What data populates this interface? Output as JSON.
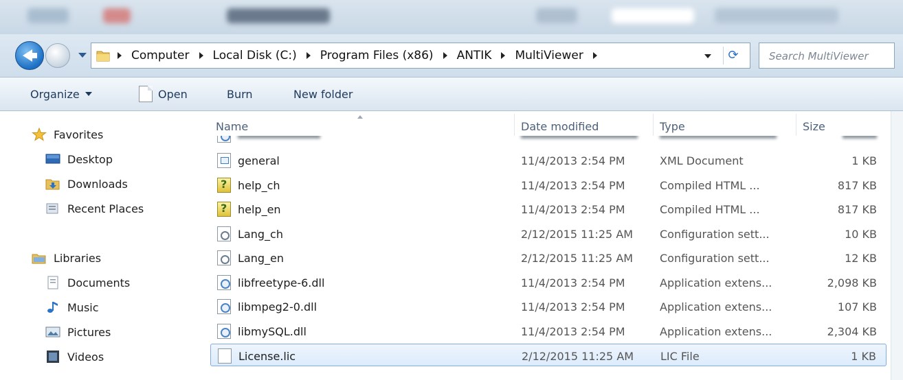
{
  "address": {
    "crumbs": [
      "Computer",
      "Local Disk (C:)",
      "Program Files (x86)",
      "ANTIK",
      "MultiViewer"
    ],
    "search_placeholder": "Search MultiViewer"
  },
  "toolbar": {
    "organize": "Organize",
    "open": "Open",
    "burn": "Burn",
    "new_folder": "New folder"
  },
  "nav": {
    "favorites": "Favorites",
    "desktop": "Desktop",
    "downloads": "Downloads",
    "recent_places": "Recent Places",
    "libraries": "Libraries",
    "documents": "Documents",
    "music": "Music",
    "pictures": "Pictures",
    "videos": "Videos"
  },
  "columns": {
    "name": "Name",
    "date_modified": "Date modified",
    "type": "Type",
    "size": "Size"
  },
  "files": [
    {
      "name": "general",
      "date": "11/4/2013 2:54 PM",
      "type": "XML Document",
      "size": "1 KB",
      "icon": "xml-icon"
    },
    {
      "name": "help_ch",
      "date": "11/4/2013 2:54 PM",
      "type": "Compiled HTML ...",
      "size": "817 KB",
      "icon": "help-icon"
    },
    {
      "name": "help_en",
      "date": "11/4/2013 2:54 PM",
      "type": "Compiled HTML ...",
      "size": "817 KB",
      "icon": "help-icon"
    },
    {
      "name": "Lang_ch",
      "date": "2/12/2015 11:25 AM",
      "type": "Configuration sett...",
      "size": "10 KB",
      "icon": "config-icon"
    },
    {
      "name": "Lang_en",
      "date": "2/12/2015 11:25 AM",
      "type": "Configuration sett...",
      "size": "12 KB",
      "icon": "config-icon"
    },
    {
      "name": "libfreetype-6.dll",
      "date": "11/4/2013 2:54 PM",
      "type": "Application extens...",
      "size": "2,098 KB",
      "icon": "dll-icon"
    },
    {
      "name": "libmpeg2-0.dll",
      "date": "11/4/2013 2:54 PM",
      "type": "Application extens...",
      "size": "107 KB",
      "icon": "dll-icon"
    },
    {
      "name": "libmySQL.dll",
      "date": "11/4/2013 2:54 PM",
      "type": "Application extens...",
      "size": "2,304 KB",
      "icon": "dll-icon"
    },
    {
      "name": "License.lic",
      "date": "2/12/2015 11:25 AM",
      "type": "LIC File",
      "size": "1 KB",
      "icon": "document-icon",
      "selected": true
    }
  ]
}
